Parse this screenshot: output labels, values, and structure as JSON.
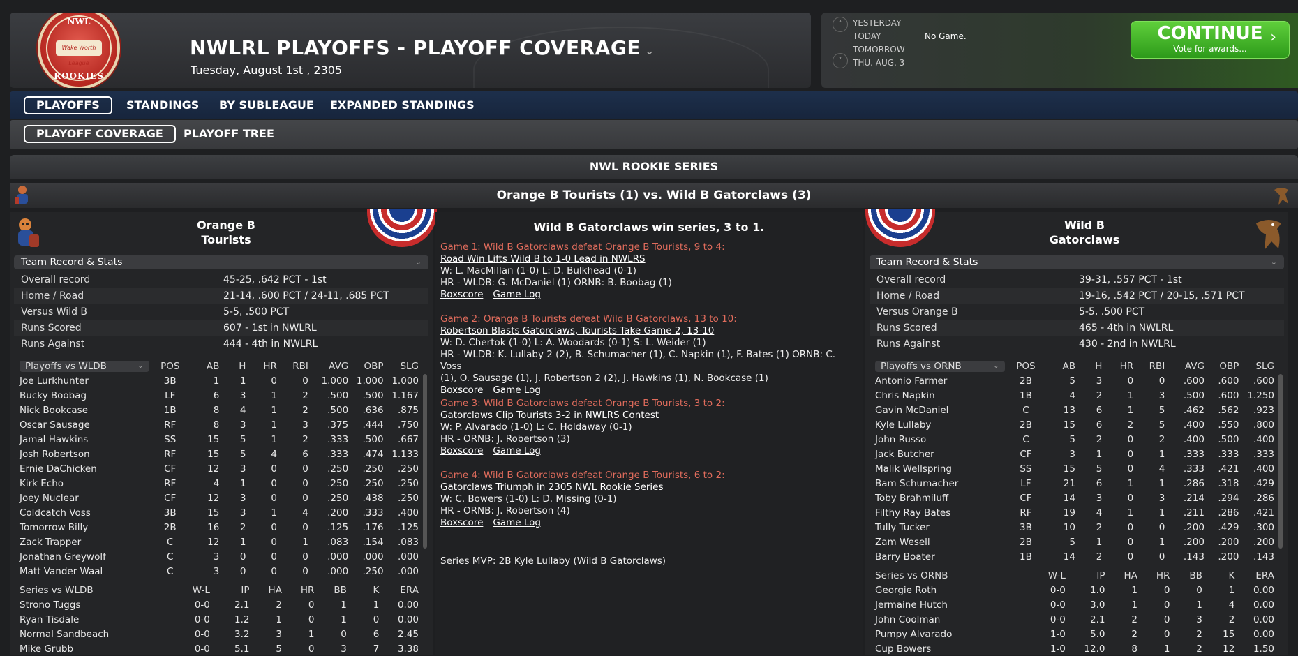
{
  "header": {
    "logo": {
      "top": "NWL",
      "middle": "Wake Worth League",
      "bottom": "ROOKIES"
    },
    "title": "NWLRL PLAYOFFS - PLAYOFF COVERAGE",
    "subtitle": "Tuesday, August 1st , 2305"
  },
  "date_nav": {
    "days": [
      "YESTERDAY",
      "TODAY",
      "TOMORROW",
      "THU. AUG. 3"
    ],
    "today_status": "No Game.",
    "continue_label": "CONTINUE",
    "continue_sub": "Vote for awards..."
  },
  "nav_primary": [
    "PLAYOFFS",
    "STANDINGS",
    "BY SUBLEAGUE",
    "EXPANDED STANDINGS"
  ],
  "nav_secondary": [
    "PLAYOFF COVERAGE",
    "PLAYOFF TREE"
  ],
  "series_title": "NWL ROOKIE SERIES",
  "matchup": "Orange B Tourists (1) vs. Wild B Gatorclaws (3)",
  "left_team": {
    "name_line1": "Orange B",
    "name_line2": "Tourists",
    "section_label": "Team Record & Stats",
    "records": [
      {
        "k": "Overall record",
        "v": "45-25, .642 PCT - 1st"
      },
      {
        "k": "Home / Road",
        "v": "21-14, .600 PCT / 24-11, .685 PCT"
      },
      {
        "k": "Versus Wild B",
        "v": "5-5, .500 PCT"
      },
      {
        "k": "Runs Scored",
        "v": "607 - 1st in NWLRL"
      },
      {
        "k": "Runs Against",
        "v": "444 - 4th in NWLRL"
      }
    ],
    "batting_label": "Playoffs vs WLDB",
    "batting_cols": [
      "POS",
      "AB",
      "H",
      "HR",
      "RBI",
      "AVG",
      "OBP",
      "SLG"
    ],
    "batting": [
      [
        "Joe Lurkhunter",
        "3B",
        "1",
        "1",
        "0",
        "0",
        "1.000",
        "1.000",
        "1.000"
      ],
      [
        "Bucky Boobag",
        "LF",
        "6",
        "3",
        "1",
        "2",
        ".500",
        ".500",
        "1.167"
      ],
      [
        "Nick Bookcase",
        "1B",
        "8",
        "4",
        "1",
        "2",
        ".500",
        ".636",
        ".875"
      ],
      [
        "Oscar Sausage",
        "RF",
        "8",
        "3",
        "1",
        "3",
        ".375",
        ".444",
        ".750"
      ],
      [
        "Jamal Hawkins",
        "SS",
        "15",
        "5",
        "1",
        "2",
        ".333",
        ".500",
        ".667"
      ],
      [
        "Josh Robertson",
        "RF",
        "15",
        "5",
        "4",
        "6",
        ".333",
        ".474",
        "1.133"
      ],
      [
        "Ernie DaChicken",
        "CF",
        "12",
        "3",
        "0",
        "0",
        ".250",
        ".250",
        ".250"
      ],
      [
        "Kirk Echo",
        "RF",
        "4",
        "1",
        "0",
        "0",
        ".250",
        ".250",
        ".250"
      ],
      [
        "Joey Nuclear",
        "CF",
        "12",
        "3",
        "0",
        "0",
        ".250",
        ".438",
        ".250"
      ],
      [
        "Coldcatch Voss",
        "3B",
        "15",
        "3",
        "1",
        "4",
        ".200",
        ".333",
        ".400"
      ],
      [
        "Tomorrow Billy",
        "2B",
        "16",
        "2",
        "0",
        "0",
        ".125",
        ".176",
        ".125"
      ],
      [
        "Zack Trapper",
        "C",
        "12",
        "1",
        "0",
        "1",
        ".083",
        ".154",
        ".083"
      ],
      [
        "Jonathan Greywolf",
        "C",
        "3",
        "0",
        "0",
        "0",
        ".000",
        ".000",
        ".000"
      ],
      [
        "Matt Vander Waal",
        "C",
        "3",
        "0",
        "0",
        "0",
        ".000",
        ".250",
        ".000"
      ]
    ],
    "pitching_label": "Series vs WLDB",
    "pitching_cols": [
      "W-L",
      "IP",
      "HA",
      "HR",
      "BB",
      "K",
      "ERA"
    ],
    "pitching": [
      [
        "Strono Tuggs",
        "0-0",
        "2.1",
        "2",
        "0",
        "1",
        "1",
        "0.00"
      ],
      [
        "Ryan Tisdale",
        "0-0",
        "1.2",
        "1",
        "0",
        "1",
        "0",
        "0.00"
      ],
      [
        "Normal Sandbeach",
        "0-0",
        "3.2",
        "3",
        "1",
        "0",
        "6",
        "2.45"
      ],
      [
        "Mike Grubb",
        "0-0",
        "5.1",
        "5",
        "0",
        "3",
        "7",
        "3.38"
      ]
    ]
  },
  "right_team": {
    "name_line1": "Wild B",
    "name_line2": "Gatorclaws",
    "section_label": "Team Record & Stats",
    "records": [
      {
        "k": "Overall record",
        "v": "39-31, .557 PCT - 1st"
      },
      {
        "k": "Home / Road",
        "v": "19-16, .542 PCT / 20-15, .571 PCT"
      },
      {
        "k": "Versus Orange B",
        "v": "5-5, .500 PCT"
      },
      {
        "k": "Runs Scored",
        "v": "465 - 4th in NWLRL"
      },
      {
        "k": "Runs Against",
        "v": "430 - 2nd in NWLRL"
      }
    ],
    "batting_label": "Playoffs vs ORNB",
    "batting_cols": [
      "POS",
      "AB",
      "H",
      "HR",
      "RBI",
      "AVG",
      "OBP",
      "SLG"
    ],
    "batting": [
      [
        "Antonio Farmer",
        "2B",
        "5",
        "3",
        "0",
        "0",
        ".600",
        ".600",
        ".600"
      ],
      [
        "Chris Napkin",
        "1B",
        "4",
        "2",
        "1",
        "3",
        ".500",
        ".600",
        "1.250"
      ],
      [
        "Gavin McDaniel",
        "C",
        "13",
        "6",
        "1",
        "5",
        ".462",
        ".562",
        ".923"
      ],
      [
        "Kyle Lullaby",
        "2B",
        "15",
        "6",
        "2",
        "5",
        ".400",
        ".550",
        ".800"
      ],
      [
        "John Russo",
        "C",
        "5",
        "2",
        "0",
        "2",
        ".400",
        ".500",
        ".400"
      ],
      [
        "Jack Butcher",
        "CF",
        "3",
        "1",
        "0",
        "1",
        ".333",
        ".333",
        ".333"
      ],
      [
        "Malik Wellspring",
        "SS",
        "15",
        "5",
        "0",
        "4",
        ".333",
        ".421",
        ".400"
      ],
      [
        "Bam Schumacher",
        "LF",
        "21",
        "6",
        "1",
        "1",
        ".286",
        ".318",
        ".429"
      ],
      [
        "Toby Brahmiluff",
        "CF",
        "14",
        "3",
        "0",
        "3",
        ".214",
        ".294",
        ".286"
      ],
      [
        "Filthy Ray Bates",
        "RF",
        "19",
        "4",
        "1",
        "1",
        ".211",
        ".286",
        ".421"
      ],
      [
        "Tully Tucker",
        "3B",
        "10",
        "2",
        "0",
        "0",
        ".200",
        ".429",
        ".300"
      ],
      [
        "Zam Wesell",
        "2B",
        "5",
        "1",
        "0",
        "1",
        ".200",
        ".200",
        ".200"
      ],
      [
        "Barry Boater",
        "1B",
        "14",
        "2",
        "0",
        "0",
        ".143",
        ".200",
        ".143"
      ]
    ],
    "pitching_label": "Series vs ORNB",
    "pitching_cols": [
      "W-L",
      "IP",
      "HA",
      "HR",
      "BB",
      "K",
      "ERA"
    ],
    "pitching": [
      [
        "Georgie Roth",
        "0-0",
        "1.0",
        "1",
        "0",
        "0",
        "1",
        "0.00"
      ],
      [
        "Jermaine Hutch",
        "0-0",
        "3.0",
        "1",
        "0",
        "1",
        "4",
        "0.00"
      ],
      [
        "John Coolman",
        "0-0",
        "2.1",
        "2",
        "0",
        "3",
        "2",
        "0.00"
      ],
      [
        "Pumpy Alvarado",
        "1-0",
        "5.0",
        "2",
        "0",
        "2",
        "15",
        "0.00"
      ],
      [
        "Cup Bowers",
        "1-0",
        "12.0",
        "8",
        "1",
        "2",
        "12",
        "1.50"
      ]
    ]
  },
  "summary": {
    "headline": "Wild B Gatorclaws win series, 3 to 1.",
    "games": [
      {
        "header": "Game 1: Wild B Gatorclaws defeat Orange B Tourists, 9 to 4:",
        "headline": "Road Win Lifts Wild B to 1-0 Lead in NWLRS",
        "wl": "W: L. MacMillan (1-0) L: D. Bulkhead (0-1)",
        "hr": "HR - WLDB: G. McDaniel (1)  ORNB: B. Boobag (1)",
        "hr2": "",
        "links": [
          "Boxscore",
          "Game Log"
        ]
      },
      {
        "header": "Game 2: Orange B Tourists defeat Wild B Gatorclaws, 13 to 10:",
        "headline": "Robertson Blasts Gatorclaws, Tourists Take Game 2, 13-10",
        "wl": "W: D. Chertok (1-0) L: A. Woodards (0-1) S: L. Weider (1)",
        "hr": "HR - WLDB: K. Lullaby 2 (2), B. Schumacher (1), C. Napkin (1), F. Bates (1)  ORNB: C. Voss",
        "hr2": "(1), O. Sausage (1), J. Robertson 2 (2), J. Hawkins (1), N. Bookcase (1)",
        "links": [
          "Boxscore",
          "Game Log"
        ]
      },
      {
        "header": "Game 3: Wild B Gatorclaws defeat Orange B Tourists, 3 to 2:",
        "headline": "Gatorclaws Clip Tourists 3-2 in NWLRS Contest",
        "wl": "W: P. Alvarado (1-0) L: C. Holdaway (0-1)",
        "hr": "HR - ORNB: J. Robertson (3)",
        "hr2": "",
        "links": [
          "Boxscore",
          "Game Log"
        ]
      },
      {
        "header": "Game 4: Wild B Gatorclaws defeat Orange B Tourists, 6 to 2:",
        "headline": "Gatorclaws Triumph in 2305 NWL Rookie Series",
        "wl": "W: C. Bowers (1-0) L: D. Missing (0-1)",
        "hr": "HR - ORNB: J. Robertson (4)",
        "hr2": "",
        "links": [
          "Boxscore",
          "Game Log"
        ]
      }
    ],
    "mvp_prefix": "Series MVP: 2B",
    "mvp_name": "Kyle Lullaby",
    "mvp_suffix": "(Wild B Gatorclaws)"
  },
  "colors": {
    "accent_green": "#3fb52a",
    "nav_blue": "#1d2f4b",
    "game_header": "#e06c5c"
  }
}
